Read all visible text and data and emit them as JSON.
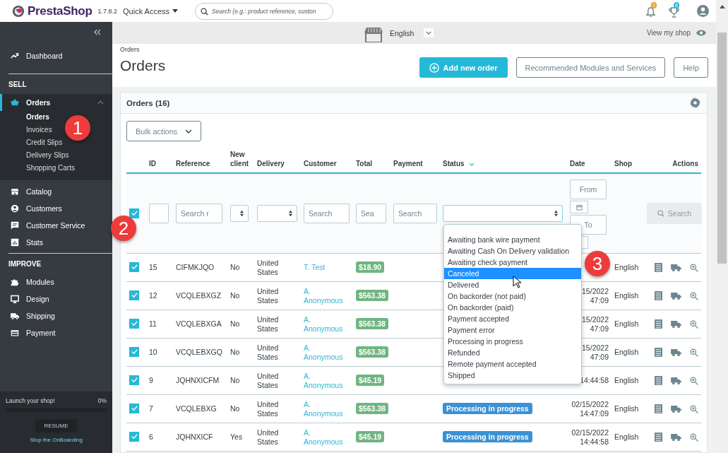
{
  "header": {
    "logo": "PrestaShop",
    "version": "1.7.8.2",
    "quick_access": "Quick Access",
    "search": {
      "placeholder": "Search (e.g.: product reference, custon"
    },
    "notifications": [
      {
        "count": "3",
        "color": "#f59c1a"
      },
      {
        "count": "8",
        "color": "#25b9d7"
      }
    ]
  },
  "subheader": {
    "language": "English",
    "view_shop": "View my shop"
  },
  "sidebar": {
    "dashboard": "Dashboard",
    "sections": [
      {
        "title": "SELL",
        "items": [
          {
            "label": "Orders",
            "selected": true,
            "expanded": true,
            "children": [
              {
                "label": "Orders",
                "selected": true
              },
              {
                "label": "Invoices",
                "selected": false
              },
              {
                "label": "Credit Slips",
                "selected": false
              },
              {
                "label": "Delivery Slips",
                "selected": false
              },
              {
                "label": "Shopping Carts",
                "selected": false
              }
            ]
          },
          {
            "label": "Catalog",
            "selected": false
          },
          {
            "label": "Customers",
            "selected": false
          },
          {
            "label": "Customer Service",
            "selected": false
          },
          {
            "label": "Stats",
            "selected": false
          }
        ]
      },
      {
        "title": "IMPROVE",
        "items": [
          {
            "label": "Modules",
            "selected": false
          },
          {
            "label": "Design",
            "selected": false
          },
          {
            "label": "Shipping",
            "selected": false
          },
          {
            "label": "Payment",
            "selected": false
          }
        ]
      }
    ],
    "onboarding": {
      "label": "Launch your shop!",
      "percent": "0%",
      "level": 0,
      "button": "RESUME",
      "link": "Stop the OnBoarding"
    }
  },
  "page": {
    "breadcrumb": "Orders",
    "title": "Orders",
    "buttons": [
      {
        "kind": "primary",
        "label": "Add new order"
      },
      {
        "kind": "outline",
        "label": "Recommended Modules and Services"
      },
      {
        "kind": "outline",
        "label": "Help"
      }
    ]
  },
  "card": {
    "title": "Orders (16)",
    "bulk_actions": "Bulk actions",
    "columns": [
      {
        "label": "ID",
        "sorted": false
      },
      {
        "label": "Reference",
        "sorted": false
      },
      {
        "label": "New client",
        "sorted": false
      },
      {
        "label": "Delivery",
        "sorted": false
      },
      {
        "label": "Customer",
        "sorted": false
      },
      {
        "label": "Total",
        "sorted": false
      },
      {
        "label": "Payment",
        "sorted": false
      },
      {
        "label": "Status",
        "sorted": true
      },
      {
        "label": "Date",
        "sorted": false
      },
      {
        "label": "Shop",
        "sorted": false
      },
      {
        "label": "Actions",
        "sorted": false
      }
    ],
    "filters": {
      "select_all_checked": true,
      "reference": {
        "placeholder": "Search r"
      },
      "customer": {
        "placeholder": "Search"
      },
      "total": {
        "placeholder": "Sea"
      },
      "payment": {
        "placeholder": "Search"
      },
      "date_from": {
        "placeholder": "From"
      },
      "date_to": {
        "placeholder": "To"
      },
      "search_button": {
        "label": "Search",
        "disabled": true
      }
    },
    "status_dropdown": {
      "options": [
        {
          "label": "Awaiting bank wire payment",
          "selected": false
        },
        {
          "label": "Awaiting Cash On Delivery validation",
          "selected": false
        },
        {
          "label": "Awaiting check payment",
          "selected": false
        },
        {
          "label": "Canceled",
          "selected": true
        },
        {
          "label": "Delivered",
          "selected": false
        },
        {
          "label": "On backorder (not paid)",
          "selected": false
        },
        {
          "label": "On backorder (paid)",
          "selected": false
        },
        {
          "label": "Payment accepted",
          "selected": false
        },
        {
          "label": "Payment error",
          "selected": false
        },
        {
          "label": "Processing in progress",
          "selected": false
        },
        {
          "label": "Refunded",
          "selected": false
        },
        {
          "label": "Remote payment accepted",
          "selected": false
        },
        {
          "label": "Shipped",
          "selected": false
        }
      ]
    },
    "rows": [
      {
        "checked": true,
        "id": "15",
        "reference": "CIFMKJQO",
        "new_client": "No",
        "delivery": "United States",
        "customer": "T. Test",
        "total": "$18.90",
        "shop": "English"
      },
      {
        "checked": true,
        "id": "12",
        "reference": "VCQLEBXGZ",
        "new_client": "No",
        "delivery": "United States",
        "customer": "A. Anonymous",
        "total": "$563.38",
        "date": "15/2022",
        "time": "47:09",
        "shop": "English"
      },
      {
        "checked": true,
        "id": "11",
        "reference": "VCQLEBXGA",
        "new_client": "No",
        "delivery": "United States",
        "customer": "A. Anonymous",
        "total": "$563.38",
        "date": "15/2022",
        "time": "47:09",
        "shop": "English"
      },
      {
        "checked": true,
        "id": "10",
        "reference": "VCQLEBXGQ",
        "new_client": "No",
        "delivery": "United States",
        "customer": "A. Anonymous",
        "total": "$563.38",
        "date": "15/2022",
        "time": "47:09",
        "shop": "English"
      },
      {
        "checked": true,
        "id": "9",
        "reference": "JQHNXICFM",
        "new_client": "No",
        "delivery": "United States",
        "customer": "A. Anonymous",
        "total": "$45.19",
        "time": "14:44:58",
        "shop": "English"
      },
      {
        "checked": true,
        "id": "7",
        "reference": "VCQLEBXG",
        "new_client": "No",
        "delivery": "United States",
        "customer": "A. Anonymous",
        "total": "$563.38",
        "status": "Processing in progress",
        "date": "02/15/2022",
        "time": "14:47:09",
        "shop": "English"
      },
      {
        "checked": true,
        "id": "6",
        "reference": "JQHNXICF",
        "new_client": "Yes",
        "delivery": "United States",
        "customer": "A. Anonymous",
        "total": "$45.19",
        "status": "Processing in progress",
        "date": "02/15/2022",
        "time": "14:44:58",
        "shop": "English"
      }
    ]
  },
  "callouts": [
    {
      "label": "1"
    },
    {
      "label": "2"
    },
    {
      "label": "3"
    }
  ]
}
